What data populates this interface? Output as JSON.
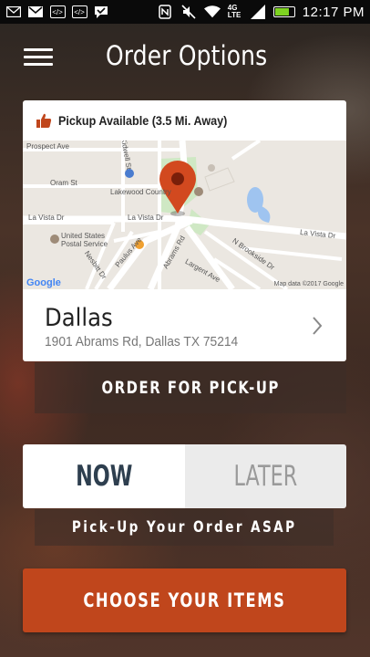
{
  "status_bar": {
    "time": "12:17 PM",
    "network": "4G LTE",
    "icons": [
      "mail-icon",
      "gmail-icon",
      "code-icon",
      "code-icon",
      "chat-bubble-icon",
      "nfc-icon",
      "mute-icon",
      "wifi-icon",
      "signal-icon",
      "battery-icon"
    ]
  },
  "header": {
    "title": "Order Options",
    "menu_icon": "hamburger-menu-icon"
  },
  "location_card": {
    "availability": "Pickup Available (3.5 Mi. Away)",
    "availability_icon": "thumbs-up-icon",
    "city": "Dallas",
    "address": "1901 Abrams Rd, Dallas TX 75214",
    "chevron_icon": "chevron-right-icon"
  },
  "map": {
    "labels": {
      "prospect": "Prospect Ave",
      "oram": "Oram St",
      "kidwell": "Kidwell St",
      "lakewood": "Lakewood Country",
      "lavista_left": "La Vista Dr",
      "lavista_mid": "La Vista Dr",
      "lavista_right": "La Vista Dr",
      "post_office": "United States\nPostal Service",
      "paulus": "Paulus Ave",
      "abrams": "Abrams Rd",
      "brookside": "N Brookside Dr",
      "largent": "Largent Ave",
      "nesbitt": "Nesbitt Dr",
      "google": "Google",
      "data": "Map data ©2017 Google"
    },
    "marker_color": "#d2491f"
  },
  "actions": {
    "pickup_label": "ORDER FOR PICK-UP",
    "time_options": {
      "now": "NOW",
      "later": "LATER",
      "selected": "NOW"
    },
    "asap_caption": "Pick-Up Your Order ASAP",
    "choose_label": "CHOOSE YOUR ITEMS"
  },
  "colors": {
    "accent": "#c0461c",
    "selected_text": "#2e3f4f",
    "unselected_text": "#9a9a9a"
  }
}
